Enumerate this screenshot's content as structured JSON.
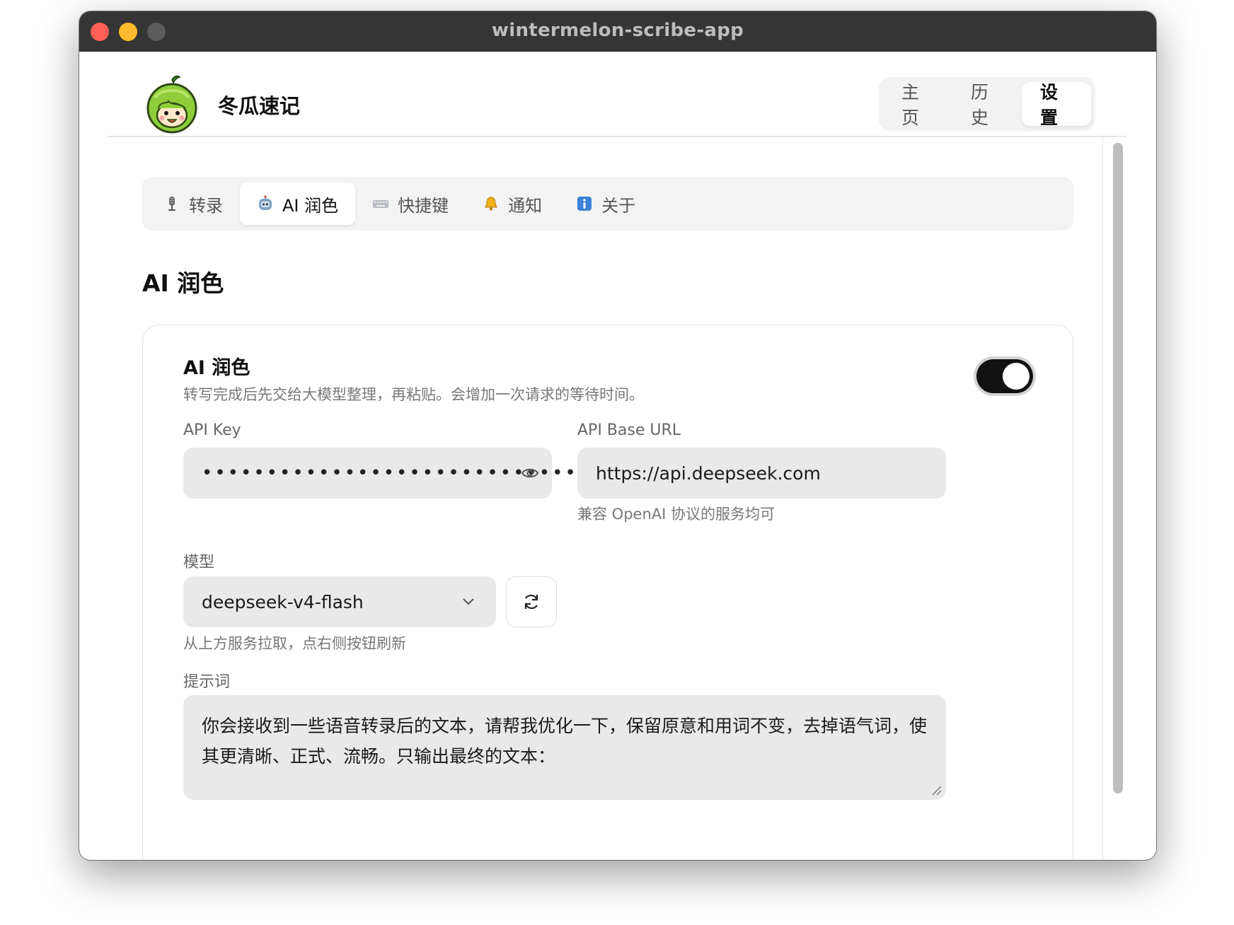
{
  "window": {
    "title": "wintermelon-scribe-app"
  },
  "header": {
    "app_name": "冬瓜速记",
    "nav": [
      {
        "label": "主页",
        "active": false
      },
      {
        "label": "历史",
        "active": false
      },
      {
        "label": "设置",
        "active": true
      }
    ]
  },
  "tabs": [
    {
      "label": "转录",
      "icon": "microphone-icon",
      "active": false
    },
    {
      "label": "AI 润色",
      "icon": "robot-icon",
      "active": true
    },
    {
      "label": "快捷键",
      "icon": "keyboard-icon",
      "active": false
    },
    {
      "label": "通知",
      "icon": "bell-icon",
      "active": false
    },
    {
      "label": "关于",
      "icon": "info-icon",
      "active": false
    }
  ],
  "section_title": "AI 润色",
  "card": {
    "title": "AI 润色",
    "description": "转写完成后先交给大模型整理，再粘贴。会增加一次请求的等待时间。",
    "enabled": true,
    "api_key": {
      "label": "API Key",
      "masked_value": "••••••••••••••••••••••••••••••"
    },
    "api_base_url": {
      "label": "API Base URL",
      "value": "https://api.deepseek.com",
      "hint": "兼容 OpenAI 协议的服务均可"
    },
    "model": {
      "label": "模型",
      "value": "deepseek-v4-flash",
      "hint": "从上方服务拉取，点右侧按钮刷新"
    },
    "prompt": {
      "label": "提示词",
      "value": "你会接收到一些语音转录后的文本，请帮我优化一下，保留原意和用词不变，去掉语气词，使其更清晰、正式、流畅。只输出最终的文本："
    }
  },
  "colors": {
    "titlebar": "#353535",
    "toggle_on": "#121212",
    "input_bg": "#e9e9e9",
    "tab_bar_bg": "#f3f3f3"
  }
}
